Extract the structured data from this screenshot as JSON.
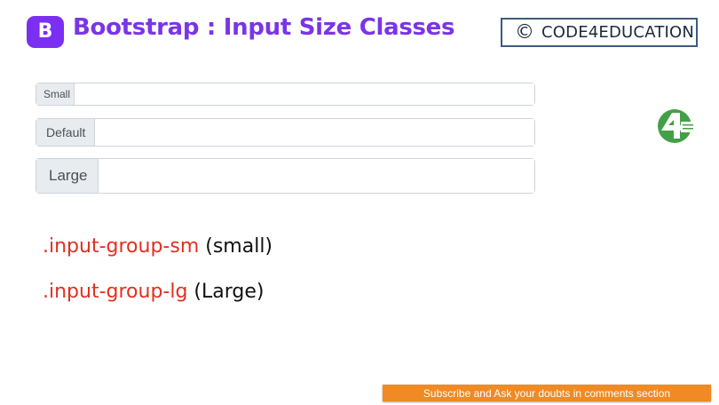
{
  "header": {
    "logo_letter": "B",
    "title": "Bootstrap : Input Size Classes",
    "badge_symbol": "©",
    "badge_text": "CODE4EDUCATION"
  },
  "input_groups": [
    {
      "addon_label": "Small",
      "value": ""
    },
    {
      "addon_label": "Default",
      "value": ""
    },
    {
      "addon_label": "Large",
      "value": ""
    }
  ],
  "notes": [
    {
      "class_name": ".input-group-sm",
      "description": " (small)"
    },
    {
      "class_name": ".input-group-lg",
      "description": " (Large)"
    }
  ],
  "footer": {
    "banner_text": "Subscribe and Ask your doubts in comments section"
  },
  "colors": {
    "brand_purple": "#7a35e6",
    "class_red": "#e0301e",
    "banner_orange": "#f08a24",
    "logo_green": "#43a047"
  },
  "icons": [
    "bootstrap-logo-icon",
    "copyright-icon",
    "code4education-logo-icon"
  ]
}
